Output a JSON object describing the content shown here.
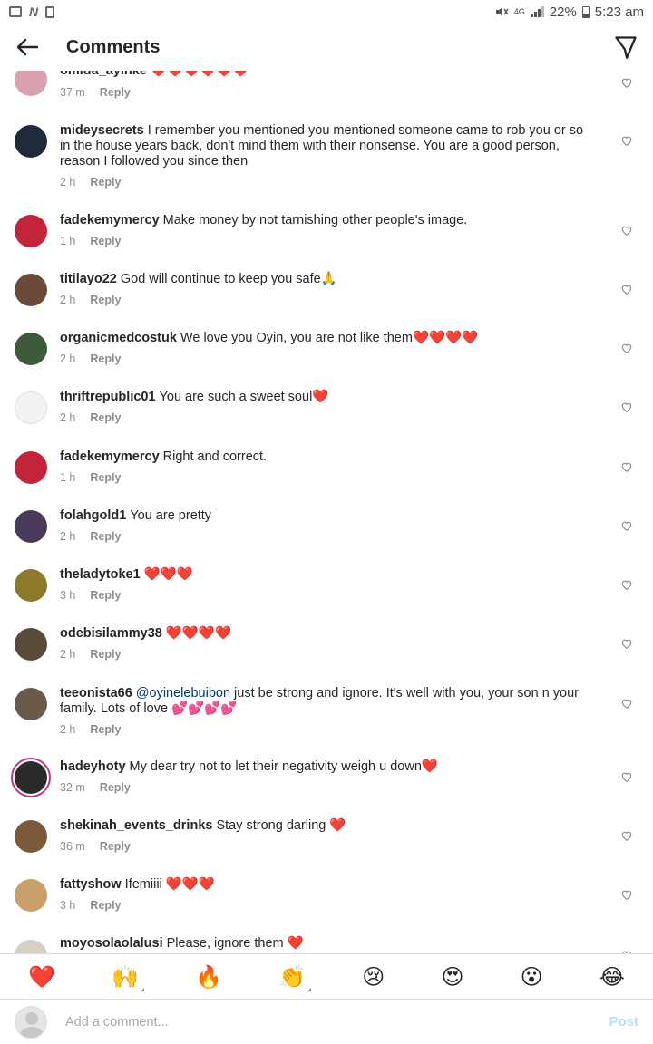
{
  "status_bar": {
    "left_icons": [
      "image-icon",
      "n-icon",
      "sim-icon"
    ],
    "network": "4G",
    "battery": "22%",
    "time": "5:23 am"
  },
  "header": {
    "title": "Comments"
  },
  "comments": [
    {
      "username": "omida_ayinke",
      "text": "❤️❤️❤️❤️❤️❤️",
      "time": "37 m",
      "reply": "Reply",
      "avatar_color": "#d9a1b0"
    },
    {
      "username": "mideysecrets",
      "text": "I remember you mentioned you mentioned someone came to rob you or so in the house years back, don't mind them with their nonsense. You are a good person, reason I followed you since then",
      "time": "2 h",
      "reply": "Reply",
      "avatar_color": "#1f2a3a"
    },
    {
      "username": "fadekemymercy",
      "text": "Make money by not tarnishing other people's image.",
      "time": "1 h",
      "reply": "Reply",
      "avatar_color": "#c2243a"
    },
    {
      "username": "titilayo22",
      "text": "God will continue to keep you safe🙏",
      "time": "2 h",
      "reply": "Reply",
      "avatar_color": "#6b4a3a"
    },
    {
      "username": "organicmedcostuk",
      "text": "We love you Oyin, you are not like them❤️❤️❤️❤️",
      "time": "2 h",
      "reply": "Reply",
      "avatar_color": "#3d5a3a"
    },
    {
      "username": "thriftrepublic01",
      "text": "You are such a sweet soul❤️",
      "time": "2 h",
      "reply": "Reply",
      "avatar_color": "#f3f3f3"
    },
    {
      "username": "fadekemymercy",
      "text": "Right and correct.",
      "time": "1 h",
      "reply": "Reply",
      "avatar_color": "#c2243a"
    },
    {
      "username": "folahgold1",
      "text": "You are pretty",
      "time": "2 h",
      "reply": "Reply",
      "avatar_color": "#4a3a5a"
    },
    {
      "username": "theladytoke1",
      "text": "❤️❤️❤️",
      "time": "3 h",
      "reply": "Reply",
      "avatar_color": "#8a7a2a"
    },
    {
      "username": "odebisilammy38",
      "text": "❤️❤️❤️❤️",
      "time": "2 h",
      "reply": "Reply",
      "avatar_color": "#5a4a3a"
    },
    {
      "username": "teeonista66",
      "mention": "@oyinelebuibon",
      "text": "just be strong and ignore. It's well with you, your son n your family. Lots of love 💕💕💕💕",
      "time": "2 h",
      "reply": "Reply",
      "avatar_color": "#6a5a4a"
    },
    {
      "username": "hadeyhoty",
      "text": "My dear try not to let their negativity weigh u down❤️",
      "time": "32 m",
      "reply": "Reply",
      "avatar_color": "#2a2a2a"
    },
    {
      "username": "shekinah_events_drinks",
      "text": "Stay strong darling ❤️",
      "time": "36 m",
      "reply": "Reply",
      "avatar_color": "#7a5a3a"
    },
    {
      "username": "fattyshow",
      "text": "Ifemiiii ❤️❤️❤️",
      "time": "3 h",
      "reply": "Reply",
      "avatar_color": "#c9a06a"
    },
    {
      "username": "moyosolaolalusi",
      "text": "Please, ignore them ❤️",
      "time": "",
      "reply": "",
      "avatar_color": "#d8cfc4"
    }
  ],
  "emoji_bar": [
    "❤️",
    "🙌",
    "🔥",
    "👏",
    "😢",
    "😍",
    "😮",
    "😂"
  ],
  "composer": {
    "placeholder": "Add a comment...",
    "post_label": "Post"
  }
}
